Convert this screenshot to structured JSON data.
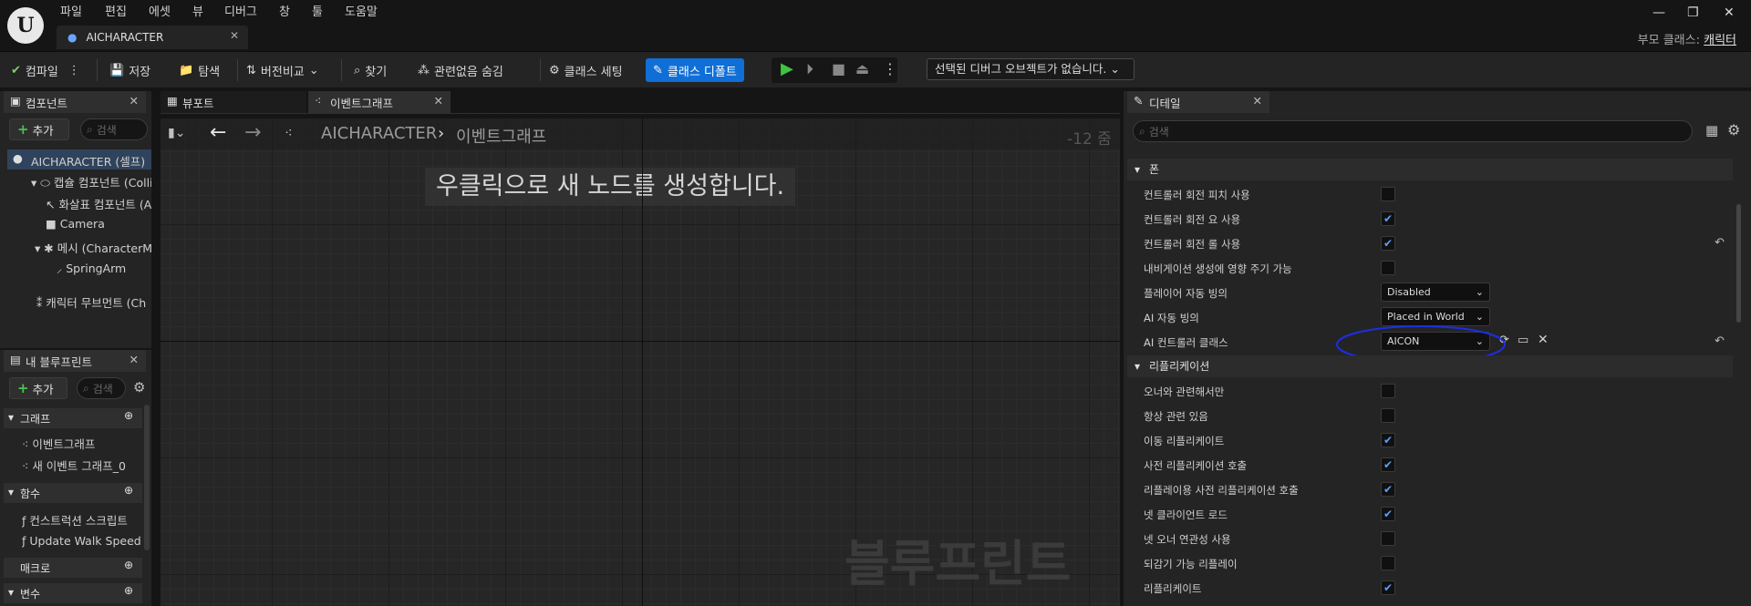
{
  "menu": [
    "파일",
    "편집",
    "에셋",
    "뷰",
    "디버그",
    "창",
    "툴",
    "도움말"
  ],
  "doc_tab": "AICHARACTER",
  "parent_class": {
    "label": "부모 클래스:",
    "value": "캐릭터"
  },
  "toolbar": {
    "compile": "컴파일",
    "save": "저장",
    "browse": "탐색",
    "diff": "버전비교",
    "find": "찾기",
    "hide_unrelated": "관련없음 숨김",
    "class_settings": "클래스 세팅",
    "class_defaults": "클래스 디폴트",
    "debug_object": "선택된 디버그 오브젝트가 없습니다."
  },
  "components": {
    "tab": "컴포넌트",
    "add": "추가",
    "search": "검색",
    "items": [
      "AICHARACTER (셀프)",
      "캡슐 컴포넌트 (Colli",
      "화살표 컴포넌트 (A",
      "Camera",
      "메시 (CharacterM",
      "SpringArm",
      "캐릭터 무브먼트 (Ch"
    ]
  },
  "my_blueprint": {
    "tab": "내 블루프린트",
    "add": "추가",
    "search": "검색",
    "sections": {
      "graphs": "그래프",
      "functions": "함수",
      "macros": "매크로",
      "variables": "변수"
    },
    "graph_items": [
      "이벤트그래프",
      "새 이벤트 그래프_0"
    ],
    "function_items": [
      "컨스트럭션 스크립트",
      "Update Walk Speed"
    ]
  },
  "graph_tabs": {
    "viewport": "뷰포트",
    "event_graph": "이벤트그래프"
  },
  "graph": {
    "breadcrumb_root": "AICHARACTER",
    "breadcrumb_leaf": "이벤트그래프",
    "zoom": "-12 줌",
    "hint": "우클릭으로 새 노드를 생성합니다.",
    "watermark": "블루프린트"
  },
  "details": {
    "tab": "디테일",
    "search": "검색",
    "pawn": {
      "title": "폰",
      "rows": [
        {
          "label": "컨트롤러 회전 피치 사용",
          "checked": false
        },
        {
          "label": "컨트롤러 회전 요 사용",
          "checked": true
        },
        {
          "label": "컨트롤러 회전 롤 사용",
          "checked": true
        },
        {
          "label": "내비게이션 생성에 영향 주기 가능",
          "checked": false
        }
      ]
    },
    "auto_possess_player": {
      "label": "플레이어 자동 빙의",
      "value": "Disabled"
    },
    "auto_possess_ai": {
      "label": "AI 자동 빙의",
      "value": "Placed in World"
    },
    "ai_controller_class": {
      "label": "AI 컨트롤러 클래스",
      "value": "AICON"
    },
    "replication": {
      "title": "리플리케이션",
      "rows": [
        {
          "label": "오너와 관련해서만",
          "checked": false
        },
        {
          "label": "항상 관련 있음",
          "checked": false
        },
        {
          "label": "이동 리플리케이트",
          "checked": true
        },
        {
          "label": "사전 리플리케이션 호출",
          "checked": true
        },
        {
          "label": "리플레이용 사전 리플리케이션 호출",
          "checked": true
        },
        {
          "label": "넷 클라이언트 로드",
          "checked": true
        },
        {
          "label": "넷 오너 연관성 사용",
          "checked": false
        },
        {
          "label": "되감기 가능 리플레이",
          "checked": false
        },
        {
          "label": "리플리케이트",
          "checked": true
        }
      ]
    }
  }
}
